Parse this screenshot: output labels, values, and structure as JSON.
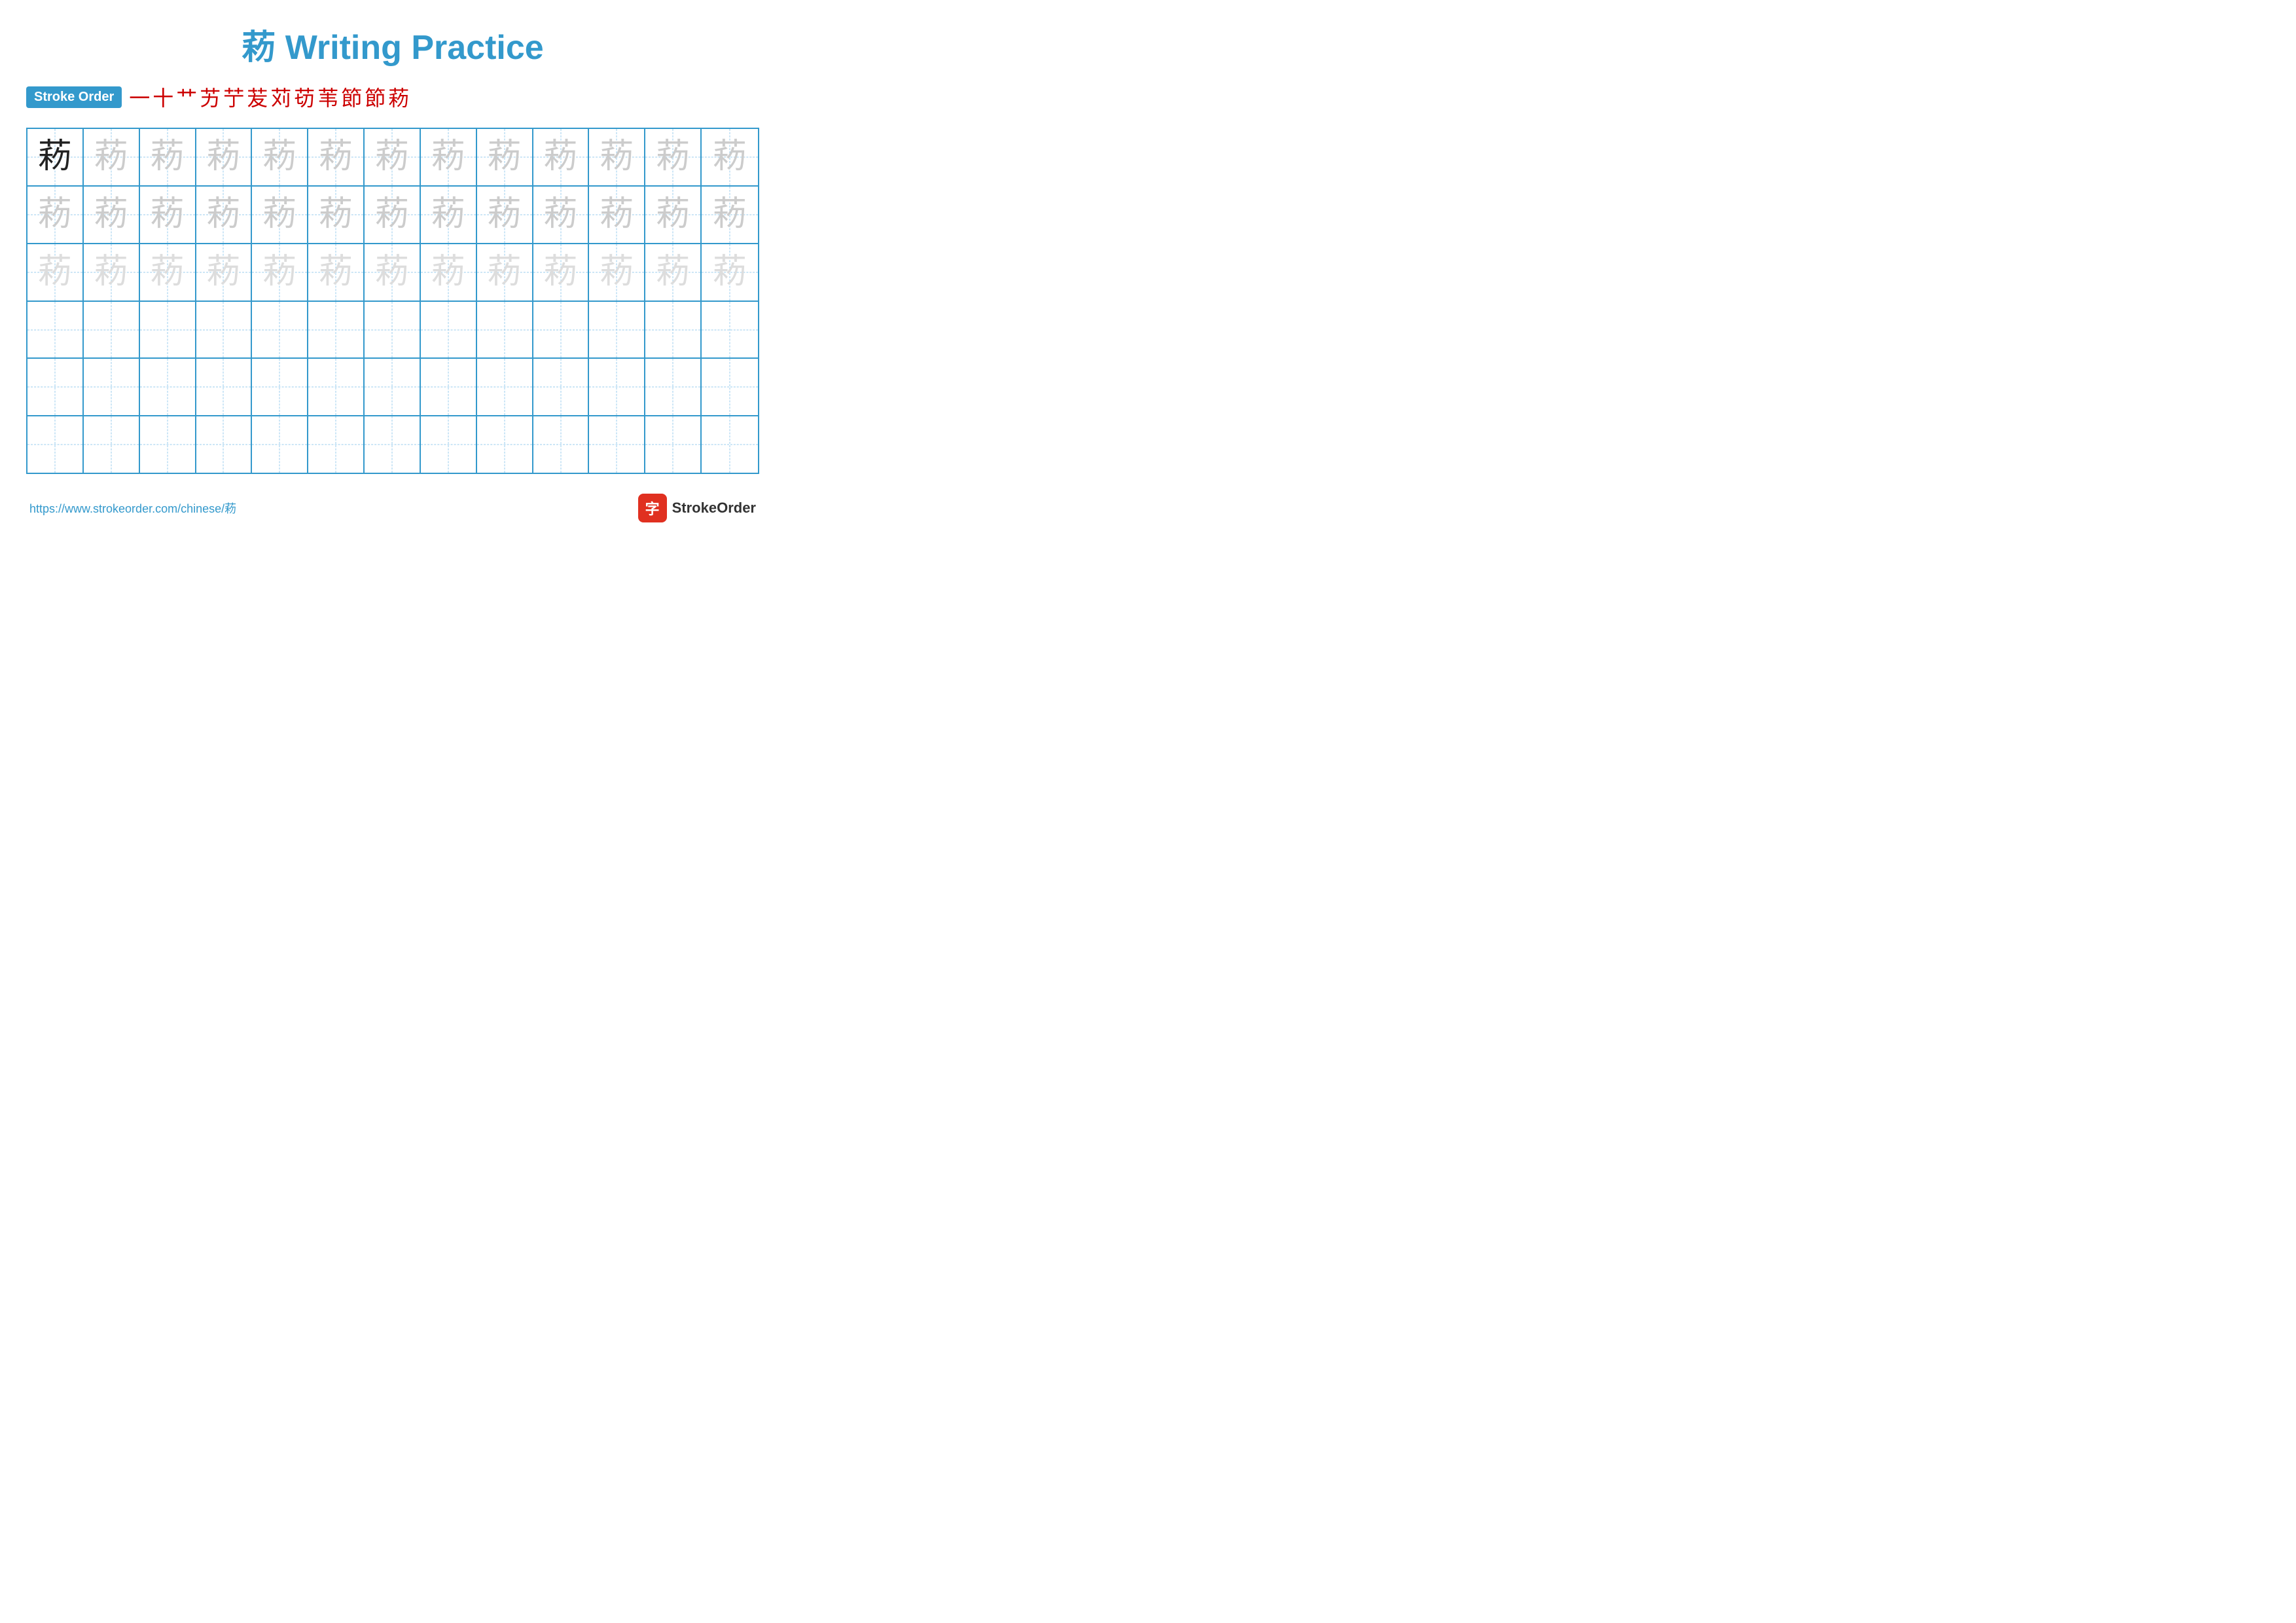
{
  "title": "菞 Writing Practice",
  "stroke_order": {
    "label": "Stroke Order",
    "chars": [
      "一",
      "十",
      "艹",
      "艻",
      "艼",
      "苃",
      "苅",
      "苆",
      "苇",
      "節",
      "節",
      "菞"
    ]
  },
  "character": "菞",
  "grid": {
    "rows": 6,
    "cols": 13,
    "row_types": [
      "dark_then_light",
      "light",
      "lighter",
      "empty",
      "empty",
      "empty"
    ]
  },
  "footer": {
    "url": "https://www.strokeorder.com/chinese/菞",
    "logo_text": "StrokeOrder",
    "logo_icon": "字"
  }
}
